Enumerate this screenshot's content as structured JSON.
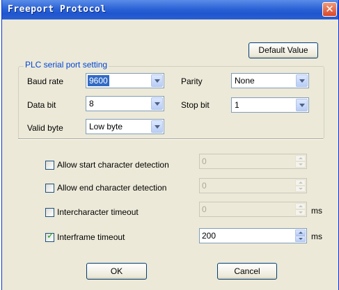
{
  "window": {
    "title": "Freeport Protocol",
    "close_glyph": "✕",
    "titlebar_color": "#2c63d6",
    "body_color": "#ece9d8"
  },
  "buttons": {
    "default_value": "Default Value",
    "ok": "OK",
    "cancel": "Cancel"
  },
  "serial_group": {
    "title": "PLC serial port setting",
    "baud_rate": {
      "label": "Baud rate",
      "value": "9600"
    },
    "parity": {
      "label": "Parity",
      "value": "None"
    },
    "data_bit": {
      "label": "Data bit",
      "value": "8"
    },
    "stop_bit": {
      "label": "Stop bit",
      "value": "1"
    },
    "valid_byte": {
      "label": "Valid byte",
      "value": "Low byte"
    }
  },
  "detection": {
    "start_char": {
      "label": "Allow start character detection",
      "checked": false,
      "value": "0",
      "enabled": false
    },
    "end_char": {
      "label": "Allow end character detection",
      "checked": false,
      "value": "0",
      "enabled": false
    },
    "intercharacter": {
      "label": "Intercharacter timeout",
      "checked": false,
      "value": "0",
      "enabled": false,
      "unit": "ms"
    },
    "interframe": {
      "label": "Interframe timeout",
      "checked": true,
      "value": "200",
      "enabled": true,
      "unit": "ms"
    }
  },
  "icons": {
    "close": "close-icon",
    "dropdown": "chevron-down-icon",
    "spin_up": "spin-up-icon",
    "spin_down": "spin-down-icon",
    "check": "checkmark-icon"
  }
}
